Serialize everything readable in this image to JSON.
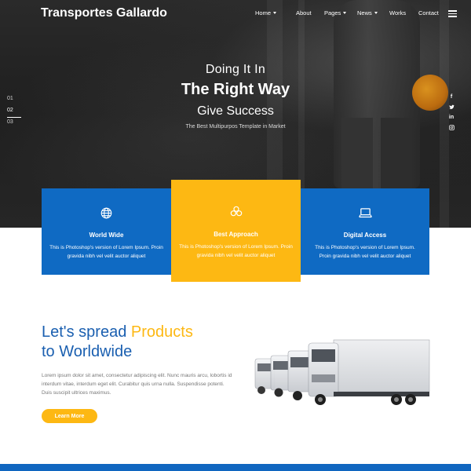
{
  "header": {
    "brand": "Transportes Gallardo",
    "menu": [
      {
        "label": "Home",
        "dropdown": true
      },
      {
        "label": "About",
        "dropdown": false
      },
      {
        "label": "Pages",
        "dropdown": true
      },
      {
        "label": "News",
        "dropdown": true
      },
      {
        "label": "Works",
        "dropdown": false
      },
      {
        "label": "Contact",
        "dropdown": false
      }
    ],
    "menu_icon": "hamburger-icon"
  },
  "hero": {
    "line1": "Doing It In",
    "line2": "The Right Way",
    "line3": "Give Success",
    "line4": "The Best Multipurpos Template in Market",
    "slides": [
      "01",
      "02",
      "03"
    ],
    "active_slide": "02",
    "social": [
      {
        "icon": "facebook-icon",
        "glyph": "f"
      },
      {
        "icon": "twitter-icon",
        "glyph": "t"
      },
      {
        "icon": "linkedin-icon",
        "glyph": "in"
      },
      {
        "icon": "instagram-icon",
        "glyph": "◎"
      }
    ]
  },
  "features": [
    {
      "icon": "globe-icon",
      "title": "World Wide",
      "desc": "This is Photoshop's version of Lorem Ipsum. Proin gravida nibh vel velit auctor aliquet",
      "color": "#0f6ac3"
    },
    {
      "icon": "coins-icon",
      "title": "Best Approach",
      "desc": "This is Photoshop's version of Lorem Ipsum. Proin gravida nibh vel velit auctor aliquet",
      "color": "#fdb813"
    },
    {
      "icon": "laptop-icon",
      "title": "Digital Access",
      "desc": "This is Photoshop's version of Lorem Ipsum. Proin gravida nibh vel velit auctor aliquet",
      "color": "#0f6ac3"
    }
  ],
  "products": {
    "heading_part1": "Let's spread ",
    "heading_accent": "Products",
    "heading_line2": "to Worldwide",
    "description": "Lorem ipsum dolor sit amet, consectetur adipiscing elit. Nunc mauris arcu, lobortis id interdum vitae, interdum eget elit. Curabitur quis urna nulla. Suspendisse potenti. Duis suscipit ultrices maximus.",
    "button": "Learn More",
    "image": "trucks-illustration"
  },
  "colors": {
    "primary_blue": "#0f6ac3",
    "accent_yellow": "#fdb813",
    "heading_blue": "#1a5fb0"
  }
}
